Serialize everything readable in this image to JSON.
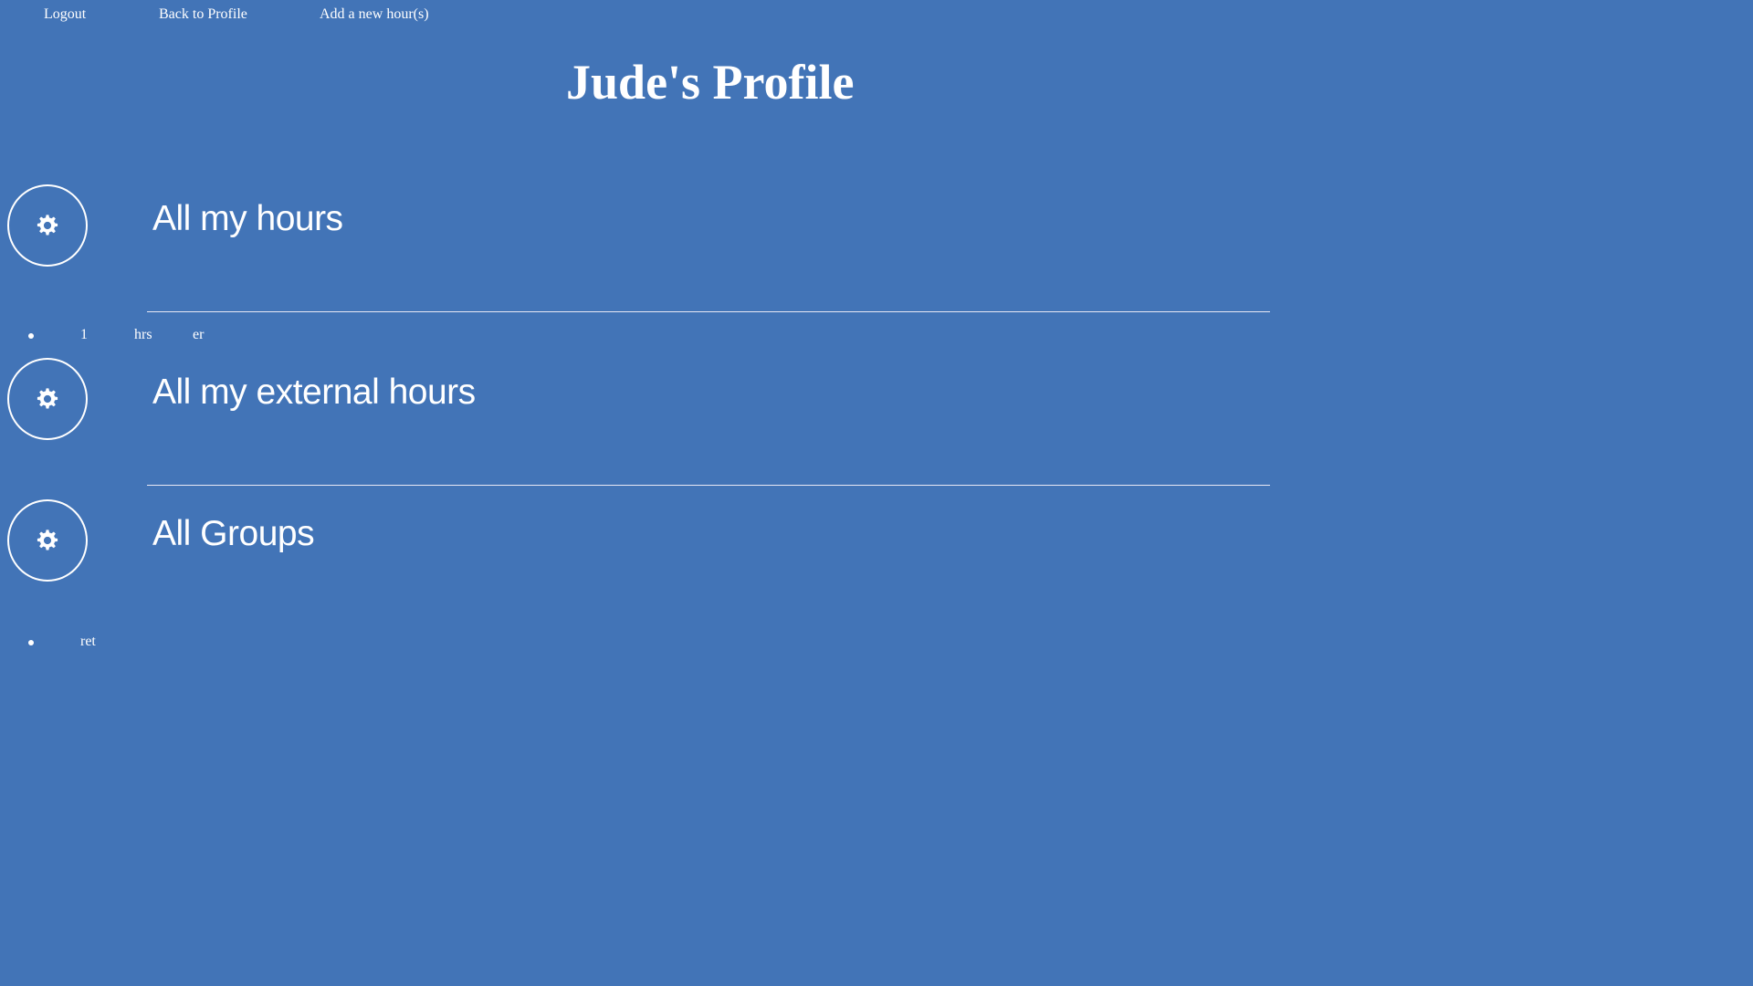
{
  "nav": {
    "logout": "Logout",
    "back_to_profile": "Back to Profile",
    "add_hours": "Add a new hour(s)"
  },
  "page_title": "Jude's Profile",
  "sections": {
    "hours": {
      "heading": "All my hours",
      "rows": [
        {
          "amount": "1",
          "unit": "hrs",
          "note": "er"
        }
      ]
    },
    "external": {
      "heading": "All my external hours"
    },
    "groups": {
      "heading": "All Groups",
      "rows": [
        {
          "name": "ret"
        }
      ]
    }
  },
  "icons": {
    "section_button": "gear-icon"
  },
  "colors": {
    "background": "#4274b7",
    "text": "#ffffff",
    "divider": "#e8e8f4"
  }
}
